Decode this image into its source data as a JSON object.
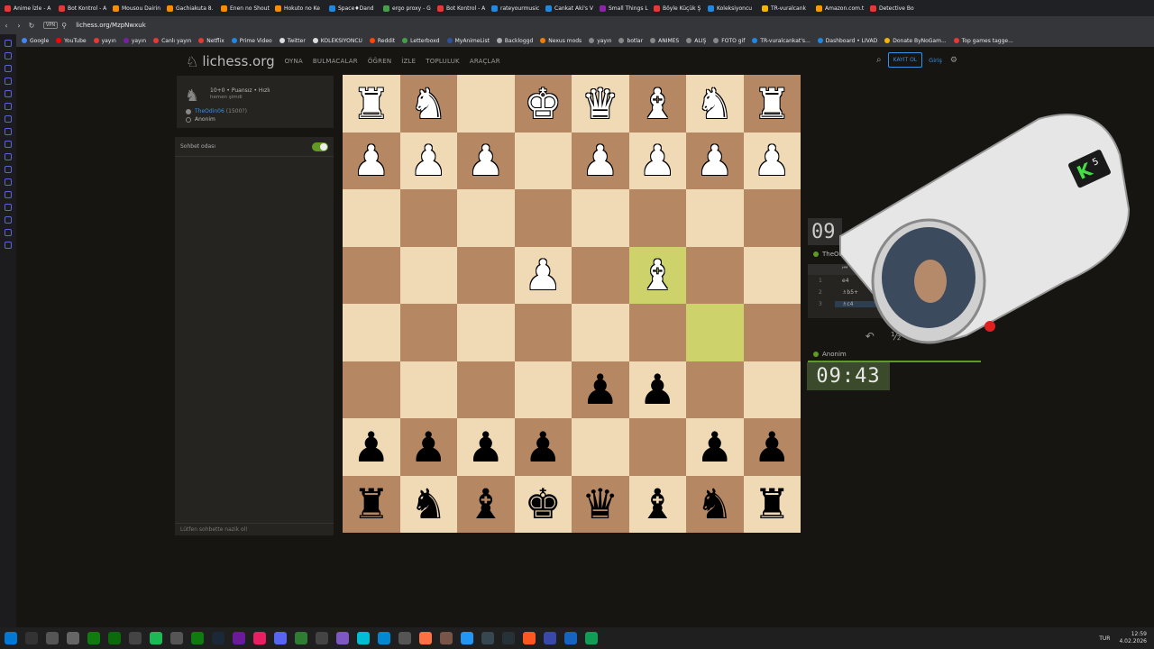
{
  "browser": {
    "tabs": [
      "Anime İzle - A",
      "Bot Kontrol - A",
      "Mousou Dairin",
      "Gachiakuta 8.",
      "Enen no Shout",
      "Hokuto no Ke",
      "Space♦Dand",
      "ergo proxy - G",
      "Bot Kontrol - A",
      "rateyourmusic",
      "Cankat Aki's V",
      "Small Things L",
      "Böyle Küçük Ş",
      "Koleksiyoncu",
      "TR-vuralcank",
      "Amazon.com.t",
      "Detective Bo"
    ],
    "url": "lichess.org/MzpNwxuk",
    "vpn": "VPN",
    "bookmarks": [
      "Google",
      "YouTube",
      "yayın",
      "yayın",
      "Canlı yayın",
      "Netflix",
      "Prime Video",
      "Twitter",
      "KOLEKSIYONCU",
      "Reddit",
      "Letterboxd",
      "MyAnimeList",
      "Backloggd",
      "Nexus mods",
      "yayın",
      "botlar",
      "ANIMES",
      "ALIŞ",
      "FOTO gif",
      "TR-vuralcankat's...",
      "Dashboard • LIVAD",
      "Donate ByNoGam...",
      "Top games tagge..."
    ]
  },
  "site": {
    "logo": "lichess.org",
    "nav": [
      "OYNA",
      "BULMACALAR",
      "ÖĞREN",
      "İZLE",
      "TOPLULUK",
      "ARAÇLAR"
    ],
    "signup": "KAYIT OL",
    "login": "Giriş"
  },
  "game_info": {
    "mode": "10+0 • Puansız • Hızlı",
    "time": "hemen şimdi",
    "white_player": "TheOdin06",
    "white_rating": "(1500?)",
    "black_player": "Anonim"
  },
  "chat": {
    "title": "Sohbet odası",
    "placeholder": "Lütfen sohbette nazik ol!"
  },
  "board": {
    "rows": [
      [
        "♜",
        "♞",
        "",
        "♚",
        "♛",
        "♝",
        "♞",
        "♜"
      ],
      [
        "♟",
        "♟",
        "♟",
        "",
        "♟",
        "♟",
        "♟",
        "♟"
      ],
      [
        "",
        "",
        "",
        "",
        "",
        "",
        "",
        ""
      ],
      [
        "",
        "",
        "",
        "♟",
        "",
        "♝",
        "",
        ""
      ],
      [
        "",
        "",
        "",
        "",
        "",
        "",
        "",
        ""
      ],
      [
        "",
        "",
        "",
        "",
        "♟",
        "♟",
        "",
        ""
      ],
      [
        "♟",
        "♟",
        "♟",
        "♟",
        "",
        "",
        "♟",
        "♟"
      ],
      [
        "♜",
        "♞",
        "♝",
        "♚",
        "♛",
        "♝",
        "♞",
        "♜"
      ]
    ],
    "colors": [
      [
        "w",
        "w",
        "",
        "w",
        "w",
        "w",
        "w",
        "w"
      ],
      [
        "w",
        "w",
        "w",
        "",
        "w",
        "w",
        "w",
        "w"
      ],
      [
        "",
        "",
        "",
        "",
        "",
        "",
        "",
        ""
      ],
      [
        "",
        "",
        "",
        "w",
        "",
        "w",
        "",
        ""
      ],
      [
        "",
        "",
        "",
        "",
        "",
        "",
        "",
        ""
      ],
      [
        "",
        "",
        "",
        "",
        "b",
        "b",
        "",
        ""
      ],
      [
        "b",
        "b",
        "b",
        "b",
        "",
        "",
        "b",
        "b"
      ],
      [
        "b",
        "b",
        "b",
        "b",
        "b",
        "b",
        "b",
        "b"
      ]
    ],
    "highlight": [
      [
        3,
        5
      ],
      [
        4,
        6
      ]
    ]
  },
  "players": {
    "top_clock": "09",
    "top_name": "TheOdin",
    "bottom_name": "Anonim",
    "bottom_clock": "09:43"
  },
  "moves": [
    {
      "n": "1",
      "w": "e4",
      "b": ""
    },
    {
      "n": "2",
      "w": "♗b5+",
      "b": ""
    },
    {
      "n": "3",
      "w": "♗c4",
      "b": ""
    }
  ],
  "actions": {
    "takeback": "↶",
    "draw": "½",
    "resign": "⚑"
  },
  "taskbar": {
    "lang": "TUR",
    "time": "12:59",
    "date": "4.02.2026"
  },
  "colors": {
    "accent": "#3692e7",
    "green": "#629924",
    "highlight": "#cdd26a"
  }
}
